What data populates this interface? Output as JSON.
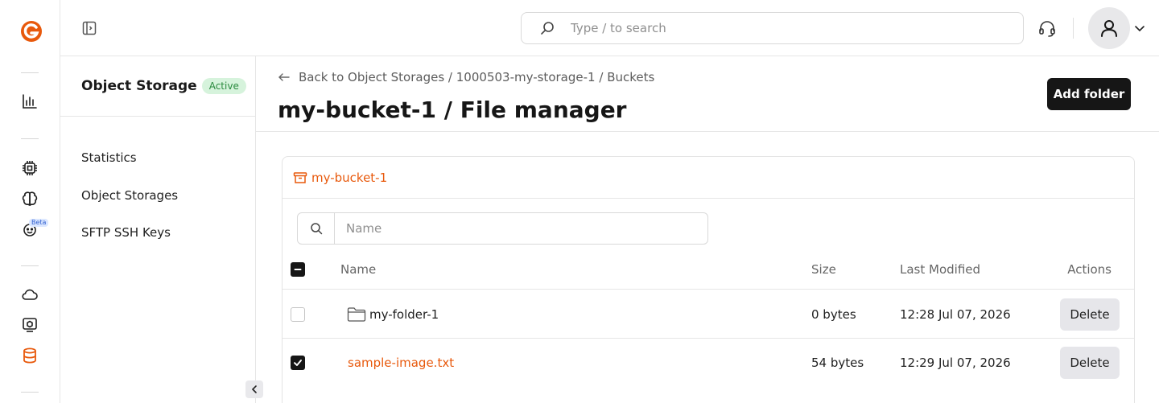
{
  "topbar": {
    "search_placeholder": "Type / to search"
  },
  "rail": {
    "beta_label": "Beta",
    "brand_color": "#e8590c",
    "icons": [
      "logo-icon",
      "statistics-icon",
      "cpu-icon",
      "brain-icon",
      "robot-icon",
      "cloud-icon",
      "server-icon",
      "database-icon"
    ]
  },
  "subnav": {
    "title": "Object Storage",
    "status": "Active",
    "items": [
      {
        "label": "Statistics"
      },
      {
        "label": "Object Storages"
      },
      {
        "label": "SFTP SSH Keys"
      }
    ]
  },
  "main": {
    "breadcrumb": [
      "Back to Object Storages",
      "1000503-my-storage-1",
      "Buckets"
    ],
    "breadcrumb_sep": "/",
    "title": "my-bucket-1 / File manager",
    "add_folder_label": "Add folder"
  },
  "file_manager": {
    "bucket_name": "my-bucket-1",
    "filter_placeholder": "Name",
    "columns": {
      "name": "Name",
      "size": "Size",
      "modified": "Last Modified",
      "actions": "Actions"
    },
    "rows": [
      {
        "name": "my-folder-1",
        "type": "folder",
        "size": "0 bytes",
        "modified": "12:28 Jul 07, 2026",
        "action": "Delete",
        "checked": false
      },
      {
        "name": "sample-image.txt",
        "type": "file",
        "size": "54 bytes",
        "modified": "12:29 Jul 07, 2026",
        "action": "Delete",
        "checked": true
      }
    ]
  }
}
